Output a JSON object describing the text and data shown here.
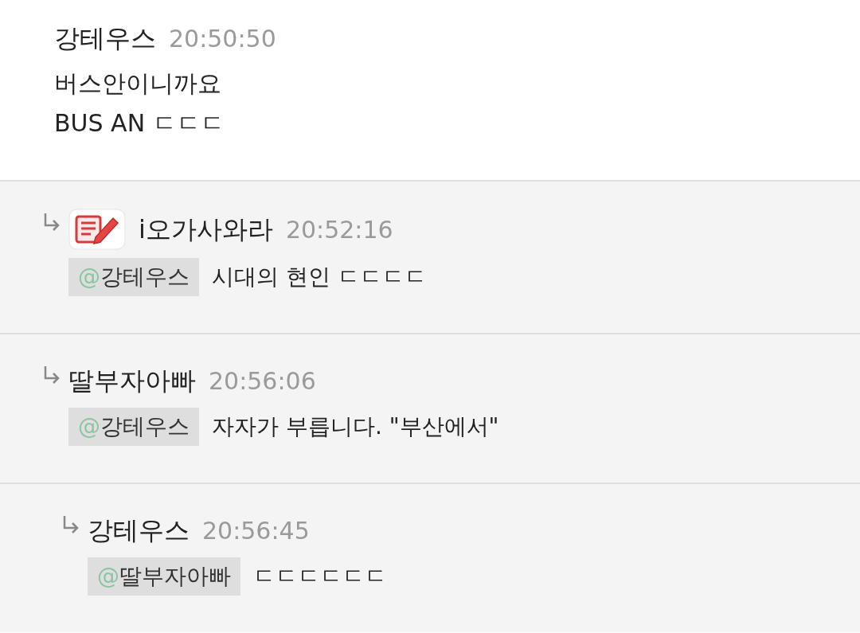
{
  "message": {
    "author": "강테우스",
    "time": "20:50:50",
    "lines": [
      "버스안이니까요",
      "BUS AN ㄷㄷㄷ"
    ]
  },
  "replies": [
    {
      "author": "i오가사와라",
      "time": "20:52:16",
      "badge": true,
      "mention": {
        "at": "@",
        "name": "강테우스"
      },
      "text": "시대의 현인 ㄷㄷㄷㄷ"
    },
    {
      "author": "딸부자아빠",
      "time": "20:56:06",
      "badge": false,
      "mention": {
        "at": "@",
        "name": "강테우스"
      },
      "text": "자자가 부릅니다. \"부산에서\"",
      "children": [
        {
          "author": "강테우스",
          "time": "20:56:45",
          "badge": false,
          "mention": {
            "at": "@",
            "name": "딸부자아빠"
          },
          "text": "ㄷㄷㄷㄷㄷㄷ"
        }
      ]
    }
  ]
}
